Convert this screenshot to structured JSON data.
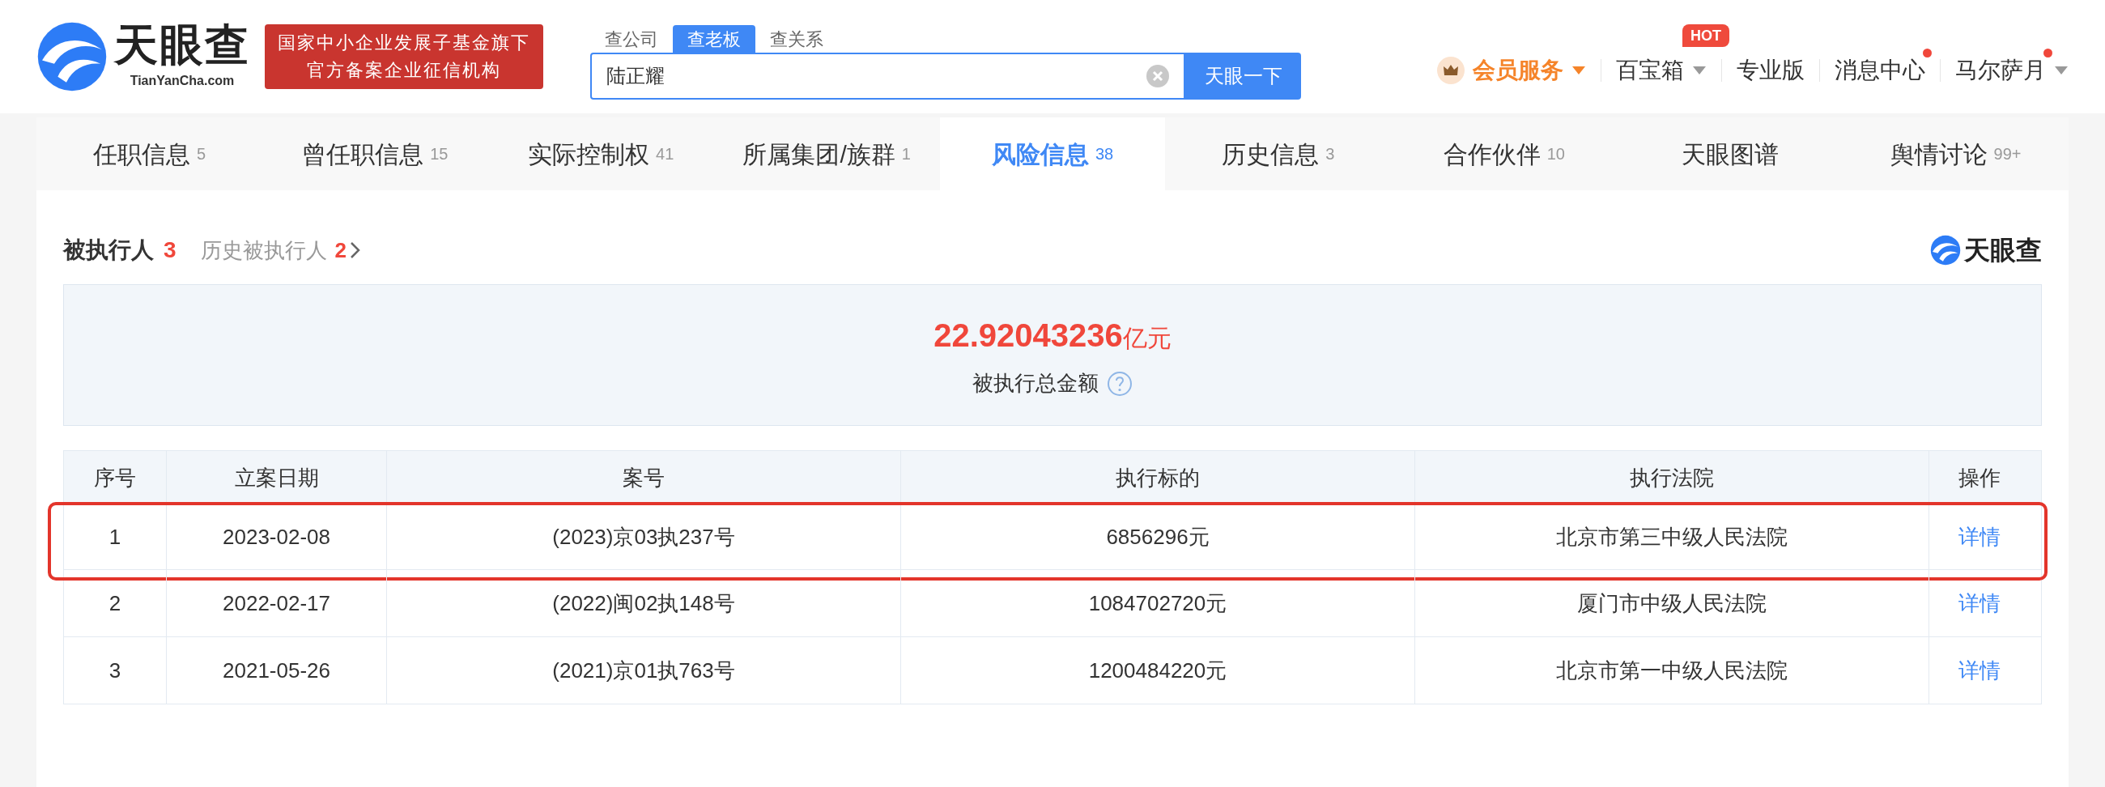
{
  "header": {
    "logo": {
      "name": "天眼查",
      "domain": "TianYanCha.com"
    },
    "badge": [
      "国家中小企业发展子基金旗下",
      "官方备案企业征信机构"
    ],
    "search": {
      "tabs": [
        {
          "label": "查公司",
          "selected": false
        },
        {
          "label": "查老板",
          "selected": true
        },
        {
          "label": "查关系",
          "selected": false
        }
      ],
      "value": "陆正耀",
      "button": "天眼一下"
    },
    "nav": [
      {
        "kind": "vip",
        "label": "会员服务",
        "dropdown": true,
        "unread": false
      },
      {
        "kind": "plain",
        "label": "百宝箱",
        "dropdown": true,
        "unread": false,
        "tag": "HOT"
      },
      {
        "kind": "plain",
        "label": "专业版",
        "dropdown": false,
        "unread": false
      },
      {
        "kind": "plain",
        "label": "消息中心",
        "dropdown": false,
        "unread": true
      },
      {
        "kind": "plain",
        "label": "马尔萨月",
        "dropdown": true,
        "unread": true
      }
    ]
  },
  "tabs": [
    {
      "label": "任职信息",
      "count": "5",
      "selected": false
    },
    {
      "label": "曾任职信息",
      "count": "15",
      "selected": false
    },
    {
      "label": "实际控制权",
      "count": "41",
      "selected": false
    },
    {
      "label": "所属集团/族群",
      "count": "1",
      "selected": false
    },
    {
      "label": "风险信息",
      "count": "38",
      "selected": true
    },
    {
      "label": "历史信息",
      "count": "3",
      "selected": false
    },
    {
      "label": "合作伙伴",
      "count": "10",
      "selected": false
    },
    {
      "label": "天眼图谱",
      "selected": false
    },
    {
      "label": "舆情讨论",
      "count": "99+",
      "selected": false
    }
  ],
  "section": {
    "title": "被执行人",
    "count": "3",
    "history_label": "历史被执行人",
    "history_count": "2",
    "brand": "天眼查",
    "summary": {
      "amount": "22.92043236",
      "unit": "亿元",
      "label": "被执行总金额"
    },
    "table": {
      "columns": [
        "序号",
        "立案日期",
        "案号",
        "执行标的",
        "执行法院",
        "操作"
      ],
      "rows": [
        {
          "cells": [
            "1",
            "2023-02-08",
            "(2023)京03执237号",
            "6856296元",
            "北京市第三中级人民法院"
          ],
          "action": "详情",
          "highlighted": true
        },
        {
          "cells": [
            "2",
            "2022-02-17",
            "(2022)闽02执148号",
            "1084702720元",
            "厦门市中级人民法院"
          ],
          "action": "详情",
          "highlighted": false
        },
        {
          "cells": [
            "3",
            "2021-05-26",
            "(2021)京01执763号",
            "1200484220元",
            "北京市第一中级人民法院"
          ],
          "action": "详情",
          "highlighted": false
        }
      ]
    }
  }
}
